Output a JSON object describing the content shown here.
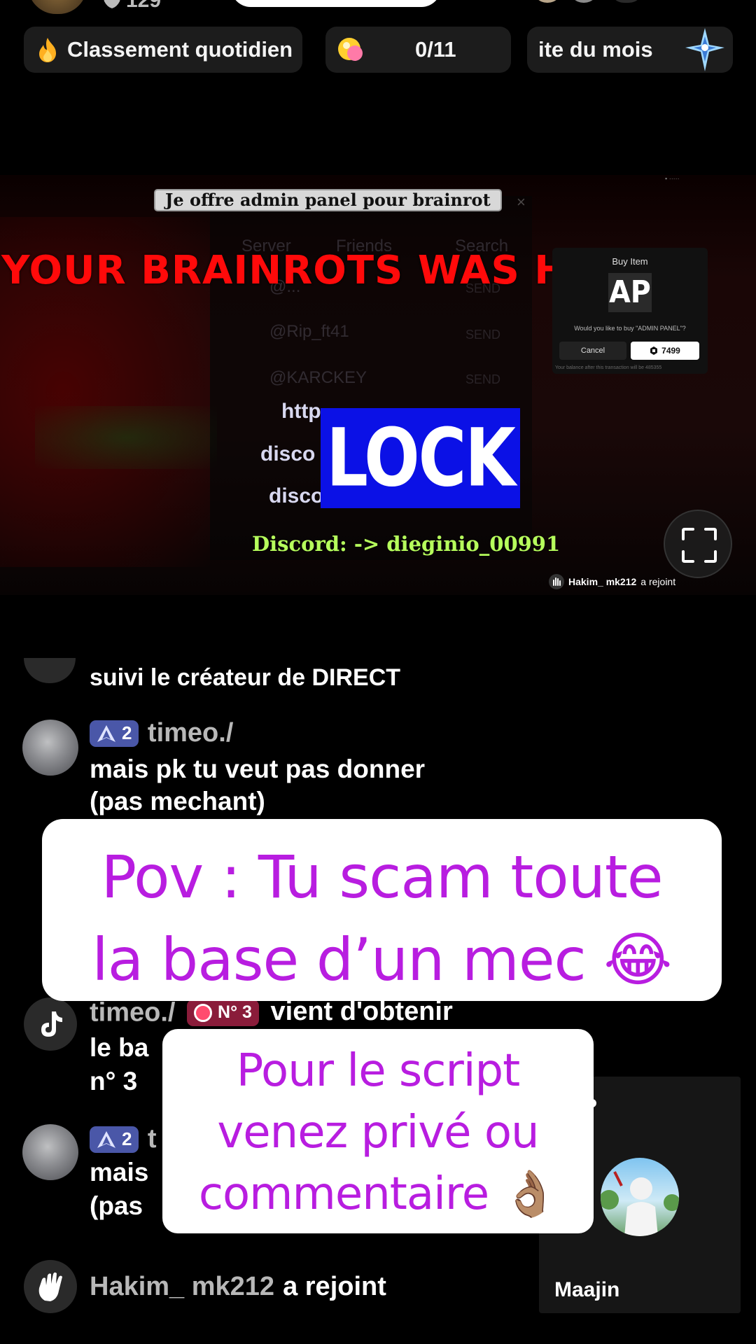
{
  "top": {
    "viewer_count": "129"
  },
  "chips": {
    "daily_ranking": "Classement quotidien",
    "goal_progress": "0/11",
    "monthly_partial": "ite du mois"
  },
  "video": {
    "caption": "Je offre admin panel pour brainrot",
    "banner": "YOUR BRAINROTS WAS H    ED",
    "ghost": {
      "tab_server": "Server",
      "tab_friends": "Friends",
      "tab_search": "Search",
      "user_1": "@...",
      "user_2": "@Rip_ft41",
      "user_3": "@KARCKEY",
      "send": "SEND"
    },
    "buy_dialog": {
      "title": "Buy Item",
      "logo": "AP",
      "question": "Would you like to buy \"ADMIN PANEL\"?",
      "cancel": "Cancel",
      "price": "7499",
      "footer": "Your balance after this transaction will be  485355"
    },
    "links": [
      "http",
      "disco",
      "disco"
    ],
    "lock_label": "LOCK",
    "discord": "Discord: -> dieginio_00991",
    "joined_name": "Hakim_ mk212",
    "joined_verb": "a rejoint"
  },
  "chat": {
    "cut_message": "suivi le créateur de DIRECT",
    "msg1": {
      "rank": "2",
      "user": "timeo./",
      "line1": "mais pk tu veut pas donner",
      "line2": "(pas mechant)"
    },
    "gift": {
      "user": "timeo./",
      "badge": "N° 3",
      "text": "vient d'obtenir",
      "line2": "le ba",
      "line3": "n° 3"
    },
    "msg2": {
      "rank": "2",
      "user_partial": "t",
      "line1": "mais",
      "line2": "(pas"
    },
    "joined": {
      "name": "Hakim_ mk212",
      "verb": "a rejoint"
    }
  },
  "guest": {
    "name": "Maajin"
  },
  "overlay": {
    "main_line1": "Pov : Tu scam toute",
    "main_line2": "la base d’un mec 😂",
    "sub_line1": "Pour le script",
    "sub_line2": "venez privé ou",
    "sub_line3": "commentaire 👌🏽"
  },
  "colors": {
    "overlay_text": "#b81de0",
    "banner_red": "#ff0a0a",
    "lock_blue": "#0b11e6",
    "discord_green": "#b6ff5c",
    "rank_badge": "#4a57a8"
  }
}
